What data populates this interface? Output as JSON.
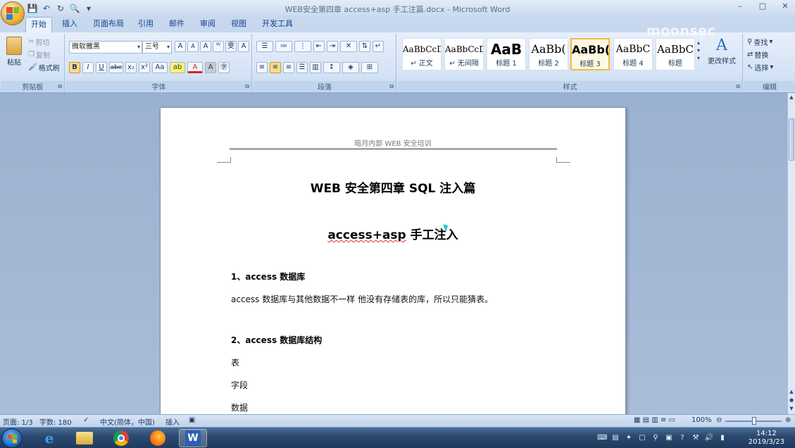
{
  "window": {
    "title": "WEB安全第四章 access+asp 手工注篇.docx - Microsoft Word",
    "controls": {
      "minimize": "–",
      "maximize": "□",
      "close": "✕"
    }
  },
  "qat": {
    "save_icon": "save-icon",
    "undo_icon": "undo-icon",
    "redo_icon": "redo-icon",
    "preview_icon": "print-preview-icon",
    "customize": "▾"
  },
  "tabs": [
    {
      "label": "开始",
      "active": true
    },
    {
      "label": "插入"
    },
    {
      "label": "页面布局"
    },
    {
      "label": "引用"
    },
    {
      "label": "邮件"
    },
    {
      "label": "审阅"
    },
    {
      "label": "视图"
    },
    {
      "label": "开发工具"
    }
  ],
  "ribbon": {
    "clipboard": {
      "label": "剪贴板",
      "paste": "粘贴",
      "cut": "剪切",
      "copy": "复制",
      "format_painter": "格式刷"
    },
    "font": {
      "label": "字体",
      "family": "微软雅黑",
      "size": "三号",
      "bold": "B",
      "italic": "I",
      "underline": "U",
      "strike": "abe",
      "subscript": "x₂",
      "superscript": "x²",
      "case": "Aa",
      "grow": "A",
      "shrink": "A",
      "clear": "A",
      "phonetic": "ᵂ",
      "wen": "雯",
      "border_a": "A",
      "highlight": "ab",
      "font_color": "A",
      "shade_a": "A",
      "enclose": "㊫"
    },
    "paragraph": {
      "label": "段落"
    },
    "styles": {
      "label": "样式",
      "items": [
        {
          "sample": "AaBbCcD",
          "name": "↵ 正文"
        },
        {
          "sample": "AaBbCcD",
          "name": "↵ 无间隔"
        },
        {
          "sample": "AaB",
          "name": "标题 1"
        },
        {
          "sample": "AaBb(",
          "name": "标题 2"
        },
        {
          "sample": "AaBb(",
          "name": "标题 3",
          "selected": true
        },
        {
          "sample": "AaBbC",
          "name": "标题 4"
        },
        {
          "sample": "AaBbC",
          "name": "标题"
        }
      ],
      "change_styles": "更改样式"
    },
    "editing": {
      "label": "编辑",
      "find": "查找",
      "replace": "替换",
      "select": "选择"
    }
  },
  "document": {
    "header": "暗月内部 WEB 安全培训",
    "title": "WEB 安全第四章 SQL 注入篇",
    "subtitle_en": "access+asp",
    "subtitle_cn": " 手工注入",
    "section1_heading": "1、access 数据库",
    "section1_text": "access 数据库与其他数据不一样 他没有存储表的库，所以只能猜表。",
    "section2_heading": "2、access 数据库结构",
    "items": [
      "表",
      "字段",
      "数据"
    ]
  },
  "statusbar": {
    "page": "页面: 1/3",
    "words": "字数: 180",
    "language": "中文(简体，中国)",
    "mode": "插入",
    "zoom": "100%"
  },
  "taskbar": {
    "apps": [
      "start-orb",
      "internet-explorer-icon",
      "file-explorer-icon",
      "chrome-icon",
      "firefox-icon",
      "word-icon"
    ],
    "time": "14:12",
    "date": "2019/3/23"
  },
  "watermark": "moonsec"
}
